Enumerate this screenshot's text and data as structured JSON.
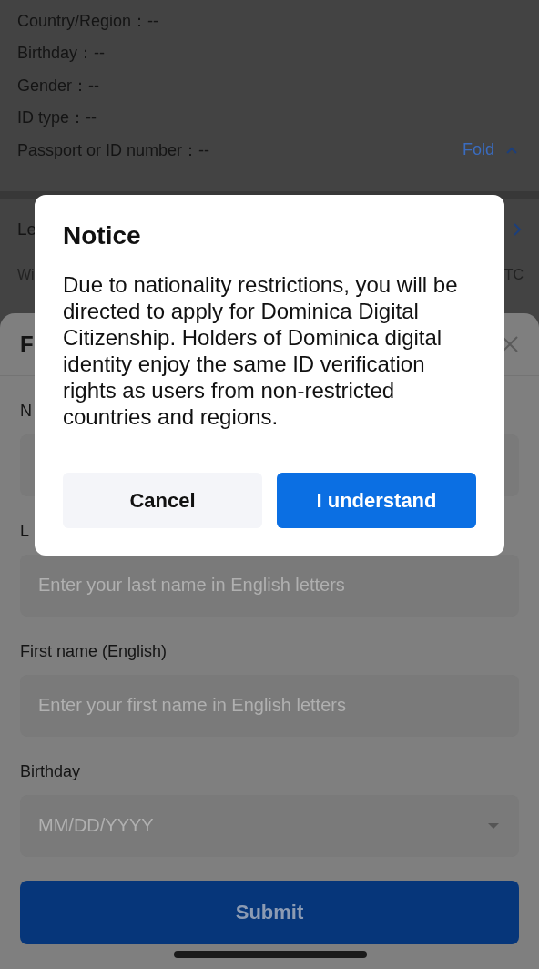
{
  "info": {
    "rows": [
      {
        "text": "Country/Region：--"
      },
      {
        "text": "Birthday：--"
      },
      {
        "text": "Gender：--"
      },
      {
        "text": "ID type：--"
      },
      {
        "text": "Passport or ID number：--"
      }
    ],
    "fold": "Fold"
  },
  "section": {
    "title": "Le",
    "subtitle": "Wi",
    "trailing": "TC"
  },
  "sheet": {
    "title": "F",
    "fields": [
      {
        "label": "N",
        "kind": "text"
      },
      {
        "label": "L",
        "kind": "text",
        "placeholder": "Enter your last name in English letters"
      },
      {
        "label": "First name (English)",
        "kind": "text",
        "placeholder": "Enter your first name in English letters"
      },
      {
        "label": "Birthday",
        "kind": "date",
        "placeholder": "MM/DD/YYYY"
      }
    ],
    "submit": "Submit"
  },
  "modal": {
    "title": "Notice",
    "message": "Due to nationality restrictions, you will be directed to apply for Dominica Digital Citizenship. Holders of Dominica digital identity enjoy the same ID verification rights as users from non-restricted countries and regions.",
    "buttons": [
      {
        "label": "Cancel",
        "kind": "secondary"
      },
      {
        "label": "I understand",
        "kind": "primary"
      }
    ]
  }
}
